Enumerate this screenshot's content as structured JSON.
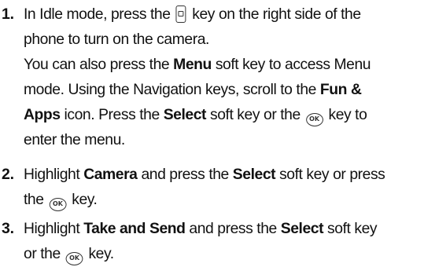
{
  "steps": [
    {
      "number": "1.",
      "lines": [
        [
          "In Idle mode, press the ",
          "[camera-key-icon]",
          " key on the right side of the"
        ],
        [
          "phone to turn on the camera."
        ],
        [
          "You can also press the ",
          "**Menu**",
          " soft key to access Menu"
        ],
        [
          "mode. Using the Navigation keys, scroll to the ",
          "**Fun &**"
        ],
        [
          "**Apps**",
          " icon. Press the ",
          "**Select**",
          " soft key or the ",
          "[ok-key-icon]",
          " key to"
        ],
        [
          "enter the menu."
        ]
      ]
    },
    {
      "number": "2.",
      "lines": [
        [
          "Highlight ",
          "**Camera**",
          " and press the ",
          "**Select**",
          " soft key or press"
        ],
        [
          "the ",
          "[ok-key-icon]",
          " key."
        ]
      ]
    },
    {
      "number": "3.",
      "lines": [
        [
          "Highlight ",
          "**Take and Send**",
          " and press the ",
          "**Select**",
          " soft key"
        ],
        [
          "or the ",
          "[ok-key-icon]",
          " key."
        ]
      ]
    }
  ],
  "icons": {
    "camera_key": "camera-key-icon",
    "ok_key": "ok-key-icon",
    "ok_key_label": "OK"
  }
}
